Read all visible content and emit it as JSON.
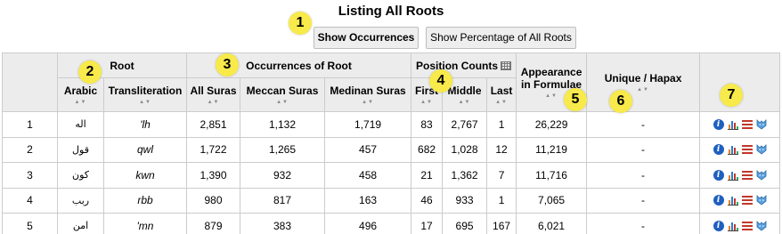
{
  "title": "Listing All Roots",
  "buttons": {
    "show_occurrences": "Show Occurrences",
    "show_percentage": "Show Percentage of All Roots"
  },
  "markers": [
    "1",
    "2",
    "3",
    "4",
    "5",
    "6",
    "7"
  ],
  "table": {
    "group_headers": {
      "root": "Root",
      "occurrences": "Occurrences of Root",
      "position_counts": "Position Counts",
      "appearance": "Appearance in Formulae",
      "unique": "Unique / Hapax"
    },
    "columns": {
      "arabic": "Arabic",
      "transliteration": "Transliteration",
      "all_suras": "All Suras",
      "meccan_suras": "Meccan Suras",
      "medinan_suras": "Medinan Suras",
      "first": "First",
      "middle": "Middle",
      "last": "Last"
    },
    "sort_glyph": "▲▼",
    "rows": [
      {
        "num": "1",
        "arabic": "اله",
        "translit": "'lh",
        "all": "2,851",
        "meccan": "1,132",
        "medinan": "1,719",
        "first": "83",
        "middle": "2,767",
        "last": "1",
        "formulae": "26,229",
        "unique": "-"
      },
      {
        "num": "2",
        "arabic": "قول",
        "translit": "qwl",
        "all": "1,722",
        "meccan": "1,265",
        "medinan": "457",
        "first": "682",
        "middle": "1,028",
        "last": "12",
        "formulae": "11,219",
        "unique": "-"
      },
      {
        "num": "3",
        "arabic": "كون",
        "translit": "kwn",
        "all": "1,390",
        "meccan": "932",
        "medinan": "458",
        "first": "21",
        "middle": "1,362",
        "last": "7",
        "formulae": "11,716",
        "unique": "-"
      },
      {
        "num": "4",
        "arabic": "ربب",
        "translit": "rbb",
        "all": "980",
        "meccan": "817",
        "medinan": "163",
        "first": "46",
        "middle": "933",
        "last": "1",
        "formulae": "7,065",
        "unique": "-"
      },
      {
        "num": "5",
        "arabic": "امن",
        "translit": "'mn",
        "all": "879",
        "meccan": "383",
        "medinan": "496",
        "first": "17",
        "middle": "695",
        "last": "167",
        "formulae": "6,021",
        "unique": "-"
      }
    ]
  },
  "row_tools": [
    "info-icon",
    "chart-icon",
    "list-icon",
    "wolfram-icon"
  ],
  "colors": {
    "marker": "#f7ea4a",
    "header_bg": "#ececec",
    "info": "#1f5fbf",
    "list": "#c0392b"
  }
}
